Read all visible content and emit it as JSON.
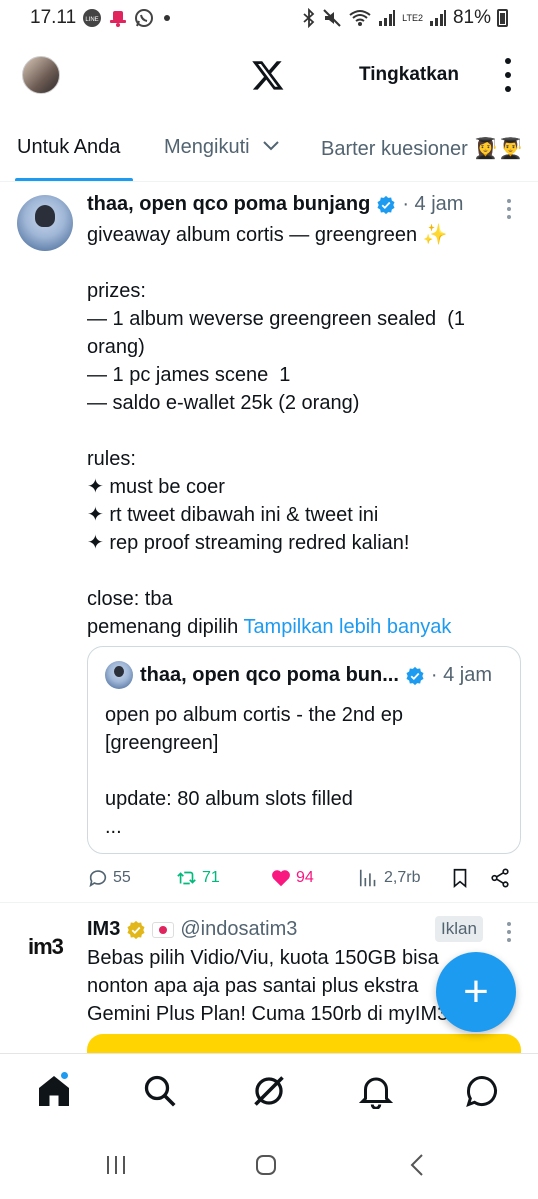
{
  "status_bar": {
    "time": "17.11",
    "battery": "81%",
    "network": "LTE2",
    "icons": [
      "line-icon",
      "hat-icon",
      "whatsapp-icon",
      "bluetooth-icon",
      "mute-icon",
      "wifi-icon",
      "signal-icon",
      "battery-icon"
    ]
  },
  "app_bar": {
    "logo": "x-logo",
    "upgrade_label": "Tingkatkan"
  },
  "tabs": [
    {
      "label": "Untuk Anda",
      "active": true
    },
    {
      "label": "Mengikuti",
      "active": false,
      "has_dropdown": true
    },
    {
      "label": "Barter kuesioner 👩‍🎓👨‍🎓",
      "active": false
    }
  ],
  "tweet": {
    "author": "thaa, open qco poma bunjang",
    "time": "· 4 jam",
    "body_lines": [
      "giveaway album cortis — greengreen ✨",
      "",
      "prizes:",
      "— 1 album weverse greengreen sealed  (1",
      "orang)",
      "— 1 pc james scene  1",
      "— saldo e-wallet 25k (2 orang)",
      "",
      "rules:",
      "✦ must be coer",
      "✦ rt tweet dibawah ini & tweet ini",
      "✦ rep proof streaming redred kalian!",
      "",
      "close: tba"
    ],
    "last_line": "pemenang dipilih",
    "show_more": "Tampilkan lebih banyak",
    "quote": {
      "author": "thaa, open qco poma bun...",
      "time": "· 4 jam",
      "body_lines": [
        "open po album cortis - the 2nd ep",
        "[greengreen]",
        "",
        "update: 80 album slots filled",
        "..."
      ]
    },
    "actions": {
      "replies": "55",
      "retweets": "71",
      "likes": "94",
      "views": "2,7rb"
    }
  },
  "ad": {
    "logo_text": "im3",
    "name": "IM3",
    "handle": "@indosatim3",
    "label": "Iklan",
    "body_lines": [
      "Bebas pilih Vidio/Viu, kuota 150GB bisa",
      "nonton apa aja pas santai plus ekstra",
      "Gemini Plus Plan! Cuma 150rb di myIM3"
    ]
  },
  "fab_label": "+",
  "bottom_nav": [
    "home-icon",
    "search-icon",
    "grok-icon",
    "notifications-icon",
    "messages-icon"
  ],
  "colors": {
    "accent": "#1d9bf0",
    "retweet": "#00ba7c",
    "like": "#f91880",
    "ad_banner": "#ffd400"
  }
}
